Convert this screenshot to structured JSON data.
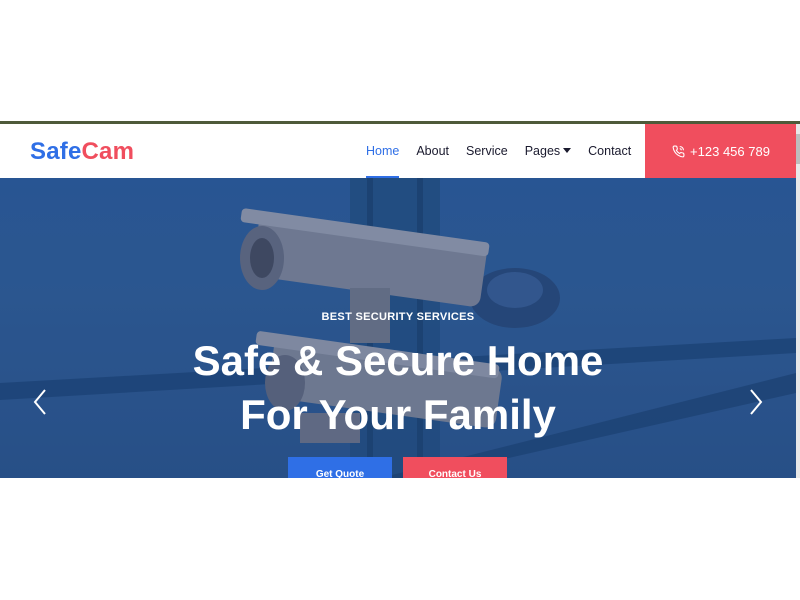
{
  "brand": {
    "part1": "Safe",
    "part2": "Cam"
  },
  "nav": {
    "items": [
      {
        "label": "Home"
      },
      {
        "label": "About"
      },
      {
        "label": "Service"
      },
      {
        "label": "Pages"
      },
      {
        "label": "Contact"
      }
    ],
    "active": "Home",
    "phone": "+123 456 789"
  },
  "hero": {
    "eyebrow": "BEST SECURITY SERVICES",
    "line1": "Safe & Secure Home",
    "line2": "For Your Family",
    "quote_button": "Get Quote",
    "contact_button": "Contact Us"
  },
  "colors": {
    "primary": "#2f6fe6",
    "accent": "#f04e5e",
    "hero_bg": "#2e5e9c"
  },
  "icons": [
    "phone-icon",
    "caret-down-icon",
    "chevron-left-icon",
    "chevron-right-icon"
  ]
}
